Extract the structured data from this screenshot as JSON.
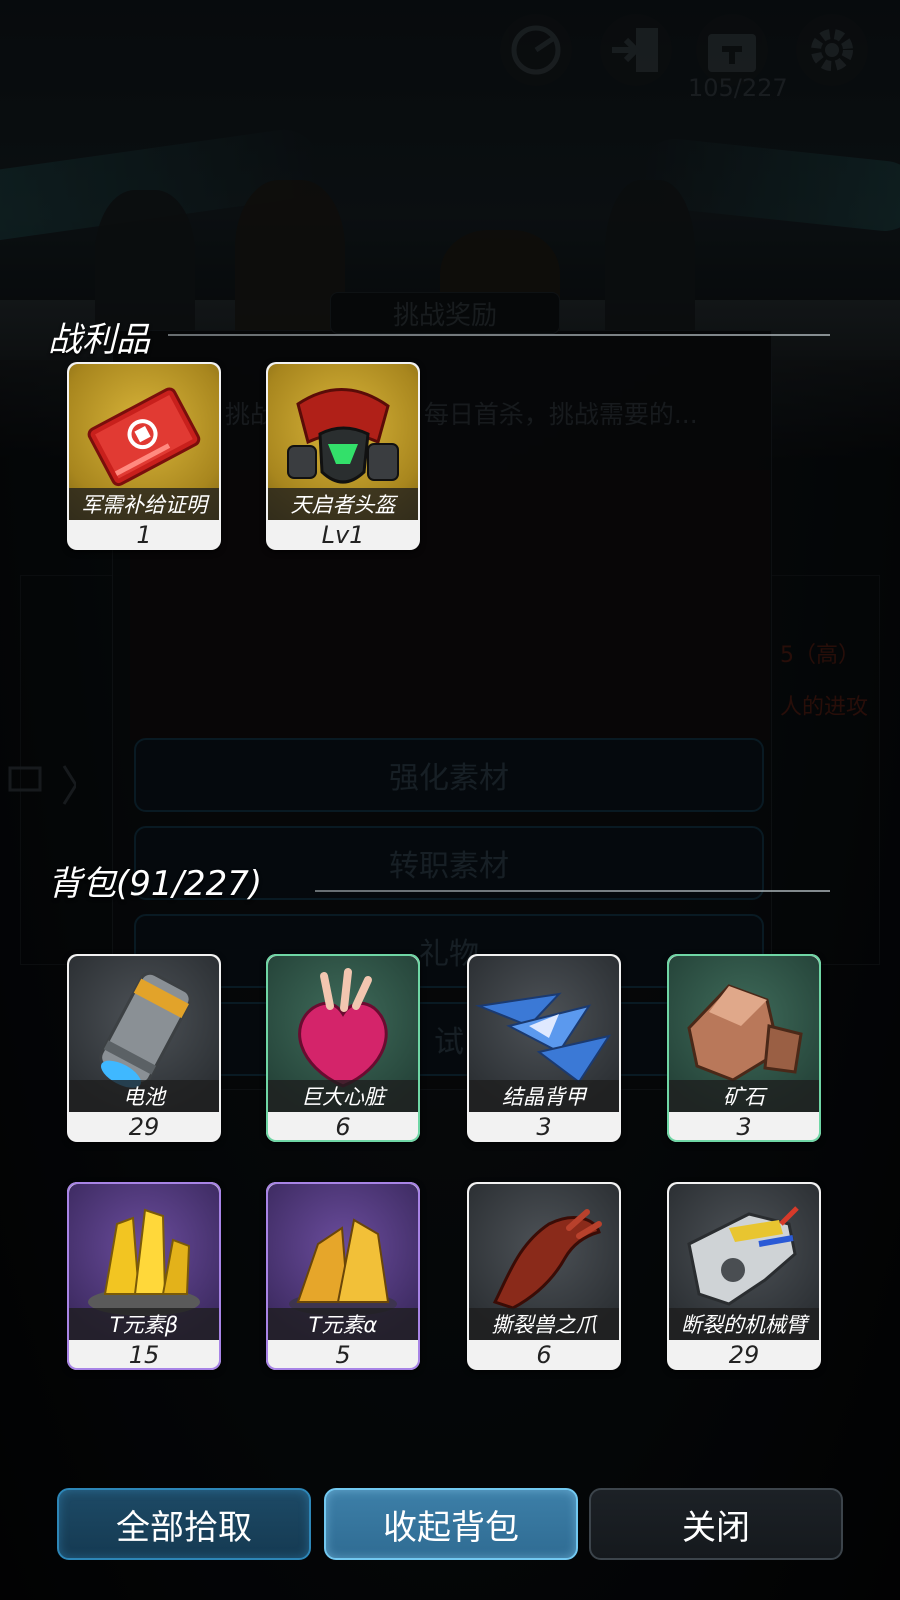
{
  "hud": {
    "count": "105/227",
    "icons": [
      "radar-icon",
      "exit-icon",
      "calendar-icon",
      "gear-icon"
    ]
  },
  "background_dialog": {
    "title": "挑战奖励",
    "description": "挑战「...防卫战」每日首杀，挑战需要的...",
    "buttons": [
      "强化素材",
      "转职素材",
      "礼物",
      "试"
    ],
    "side_text_1": "5（高）",
    "side_text_2": "人的进攻"
  },
  "loot": {
    "title": "战利品",
    "items": [
      {
        "name": "军需补给证明",
        "count": "1",
        "rarity": "gold",
        "icon": "supply-ticket-icon"
      },
      {
        "name": "天启者头盔",
        "count": "Lv1",
        "rarity": "gold",
        "icon": "helmet-icon"
      }
    ]
  },
  "backpack": {
    "title": "背包(91/227)",
    "items": [
      {
        "name": "电池",
        "count": "29",
        "rarity": "grey",
        "icon": "battery-icon"
      },
      {
        "name": "巨大心脏",
        "count": "6",
        "rarity": "green",
        "icon": "heart-icon"
      },
      {
        "name": "结晶背甲",
        "count": "3",
        "rarity": "grey",
        "icon": "crystal-shell-icon"
      },
      {
        "name": "矿石",
        "count": "3",
        "rarity": "green",
        "icon": "ore-icon"
      },
      {
        "name": "T元素β",
        "count": "15",
        "rarity": "purple",
        "icon": "t-element-beta-icon"
      },
      {
        "name": "T元素α",
        "count": "5",
        "rarity": "purple",
        "icon": "t-element-alpha-icon"
      },
      {
        "name": "撕裂兽之爪",
        "count": "6",
        "rarity": "grey",
        "icon": "claw-icon"
      },
      {
        "name": "断裂的机械臂",
        "count": "29",
        "rarity": "grey",
        "icon": "mech-arm-icon"
      }
    ]
  },
  "buttons": {
    "pick_all": "全部拾取",
    "collapse_bag": "收起背包",
    "close": "关闭"
  }
}
